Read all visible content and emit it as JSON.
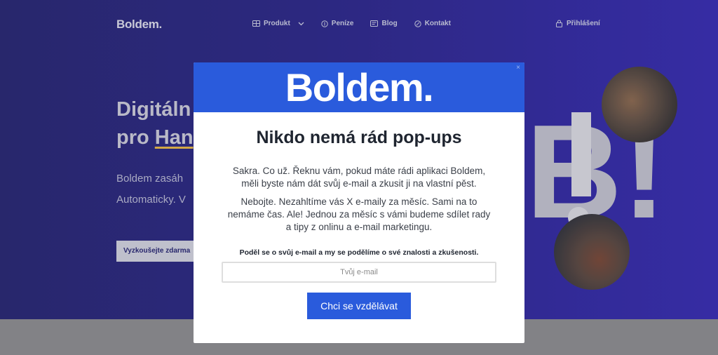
{
  "site": {
    "logo": "Boldem."
  },
  "nav": {
    "items": [
      {
        "label": "Produkt",
        "icon": "grid-icon",
        "has_dropdown": true
      },
      {
        "label": "Peníze",
        "icon": "coin-icon",
        "has_dropdown": false
      },
      {
        "label": "Blog",
        "icon": "document-icon",
        "has_dropdown": false
      },
      {
        "label": "Kontakt",
        "icon": "compass-icon",
        "has_dropdown": false
      }
    ],
    "login": "Přihlášení"
  },
  "hero": {
    "title_line1": "Digitáln",
    "title_line2_a": "pro ",
    "title_line2_b": "Han",
    "text_line1": "Boldem zasáh",
    "text_line2": "Automaticky. V",
    "cta": "Vyzkoušejte zdarma",
    "decor_letter": "B!"
  },
  "modal": {
    "logo": "Boldem.",
    "close": "×",
    "title": "Nikdo nemá rád pop-ups",
    "paragraph1": "Sakra. Co už. Řeknu vám, pokud máte rádi aplikaci Boldem, měli byste nám dát svůj e-mail a zkusit ji na vlastní pěst.",
    "paragraph2": "Nebojte. Nezahltíme vás X e-maily za měsíc. Sami na to nemáme čas. Ale! Jednou za měsíc s vámi budeme sdílet rady a tipy z onlinu a e-mail marketingu.",
    "label": "Poděl se o svůj e-mail a my se podělíme o své znalosti a zkušenosti.",
    "email_placeholder": "Tvůj e-mail",
    "email_value": "",
    "submit": "Chci se vzdělávat"
  },
  "colors": {
    "brand_blue": "#2a5bdc",
    "page_bg": "#2f2b8a",
    "accent_underline": "#e4b54a"
  }
}
